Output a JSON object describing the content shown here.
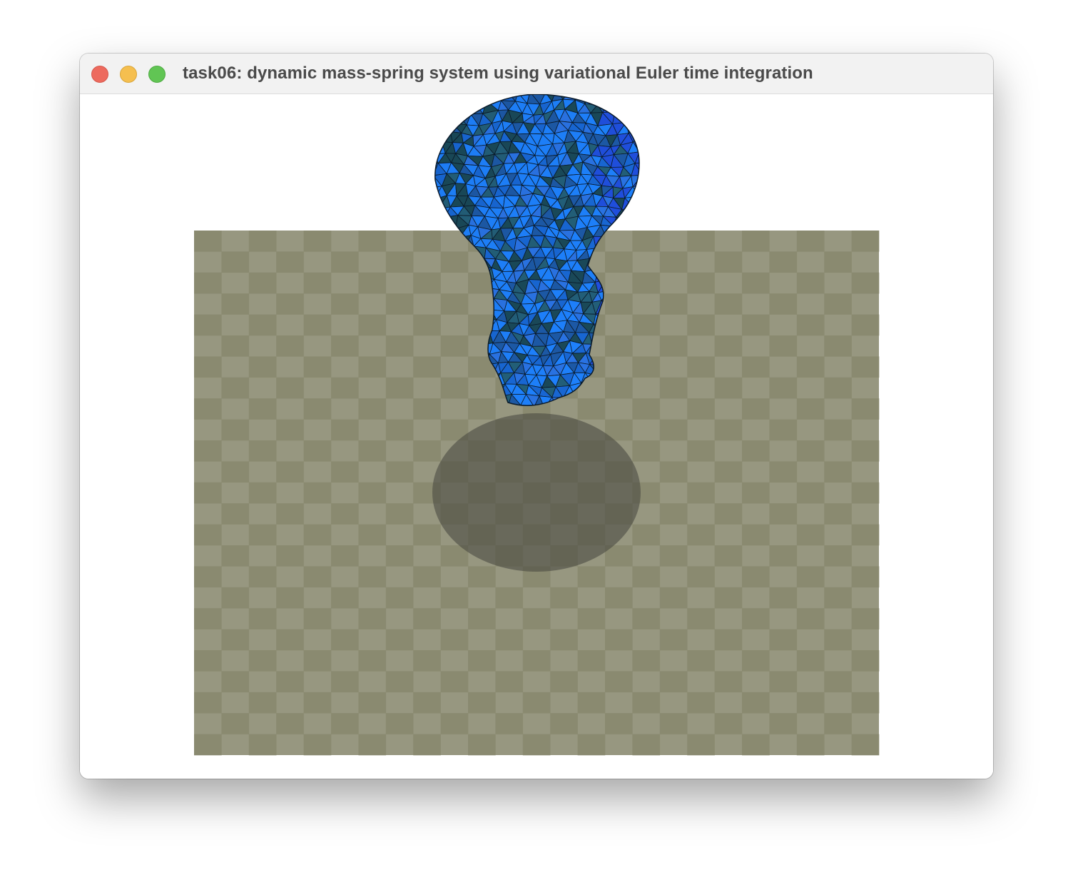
{
  "window": {
    "title": "task06: dynamic mass-spring system using variational Euler time integration",
    "controls": [
      "close",
      "minimize",
      "zoom"
    ]
  },
  "scene": {
    "background_color": "#ffffff",
    "floor": {
      "checker_light": "#979780",
      "checker_dark": "#8a8a70"
    },
    "shadow_color": "#4e4e44",
    "cloth": {
      "color_light": "#1e82ff",
      "color_mid": "#1868d6",
      "color_dark": "#1a4a5a",
      "edge_color": "#0a1a2a"
    }
  }
}
